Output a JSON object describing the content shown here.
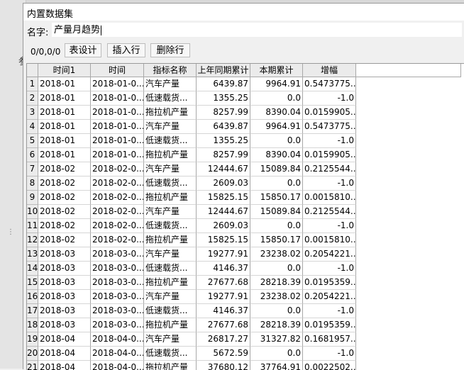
{
  "dialog": {
    "title": "内置数据集",
    "name_label": "名字:",
    "name_value": "产量月趋势"
  },
  "underlay": {
    "char": "参",
    "grip": "⋮"
  },
  "toolbar": {
    "counter": "0/0,0/0",
    "design_label": "表设计",
    "insert_label": "插入行",
    "delete_label": "删除行"
  },
  "table": {
    "columns": [
      "时间1",
      "时间",
      "指标名称",
      "上年同期累计",
      "本期累计",
      "增幅"
    ],
    "rows": [
      [
        "1",
        "2018-01",
        "2018-01-0...",
        "汽车产量",
        "6439.87",
        "9964.91",
        "0.5473775..."
      ],
      [
        "2",
        "2018-01",
        "2018-01-0...",
        "低速载货...",
        "1355.25",
        "0.0",
        "-1.0"
      ],
      [
        "3",
        "2018-01",
        "2018-01-0...",
        "拖拉机产量",
        "8257.99",
        "8390.04",
        "0.0159905..."
      ],
      [
        "4",
        "2018-01",
        "2018-01-0...",
        "汽车产量",
        "6439.87",
        "9964.91",
        "0.5473775..."
      ],
      [
        "5",
        "2018-01",
        "2018-01-0...",
        "低速载货...",
        "1355.25",
        "0.0",
        "-1.0"
      ],
      [
        "6",
        "2018-01",
        "2018-01-0...",
        "拖拉机产量",
        "8257.99",
        "8390.04",
        "0.0159905..."
      ],
      [
        "7",
        "2018-02",
        "2018-02-0...",
        "汽车产量",
        "12444.67",
        "15089.84",
        "0.2125544..."
      ],
      [
        "8",
        "2018-02",
        "2018-02-0...",
        "低速载货...",
        "2609.03",
        "0.0",
        "-1.0"
      ],
      [
        "9",
        "2018-02",
        "2018-02-0...",
        "拖拉机产量",
        "15825.15",
        "15850.17",
        "0.0015810..."
      ],
      [
        "10",
        "2018-02",
        "2018-02-0...",
        "汽车产量",
        "12444.67",
        "15089.84",
        "0.2125544..."
      ],
      [
        "11",
        "2018-02",
        "2018-02-0...",
        "低速载货...",
        "2609.03",
        "0.0",
        "-1.0"
      ],
      [
        "12",
        "2018-02",
        "2018-02-0...",
        "拖拉机产量",
        "15825.15",
        "15850.17",
        "0.0015810..."
      ],
      [
        "13",
        "2018-03",
        "2018-03-0...",
        "汽车产量",
        "19277.91",
        "23238.02",
        "0.2054221..."
      ],
      [
        "14",
        "2018-03",
        "2018-03-0...",
        "低速载货...",
        "4146.37",
        "0.0",
        "-1.0"
      ],
      [
        "15",
        "2018-03",
        "2018-03-0...",
        "拖拉机产量",
        "27677.68",
        "28218.39",
        "0.0195359..."
      ],
      [
        "16",
        "2018-03",
        "2018-03-0...",
        "汽车产量",
        "19277.91",
        "23238.02",
        "0.2054221..."
      ],
      [
        "17",
        "2018-03",
        "2018-03-0...",
        "低速载货...",
        "4146.37",
        "0.0",
        "-1.0"
      ],
      [
        "18",
        "2018-03",
        "2018-03-0...",
        "拖拉机产量",
        "27677.68",
        "28218.39",
        "0.0195359..."
      ],
      [
        "19",
        "2018-04",
        "2018-04-0...",
        "汽车产量",
        "26817.27",
        "31327.82",
        "0.1681957..."
      ],
      [
        "20",
        "2018-04",
        "2018-04-0...",
        "低速载货...",
        "5672.59",
        "0.0",
        "-1.0"
      ],
      [
        "21",
        "2018-04",
        "2018-04-0...",
        "拖拉机产量",
        "37680.12",
        "37764.91",
        "0.0022502..."
      ]
    ]
  }
}
